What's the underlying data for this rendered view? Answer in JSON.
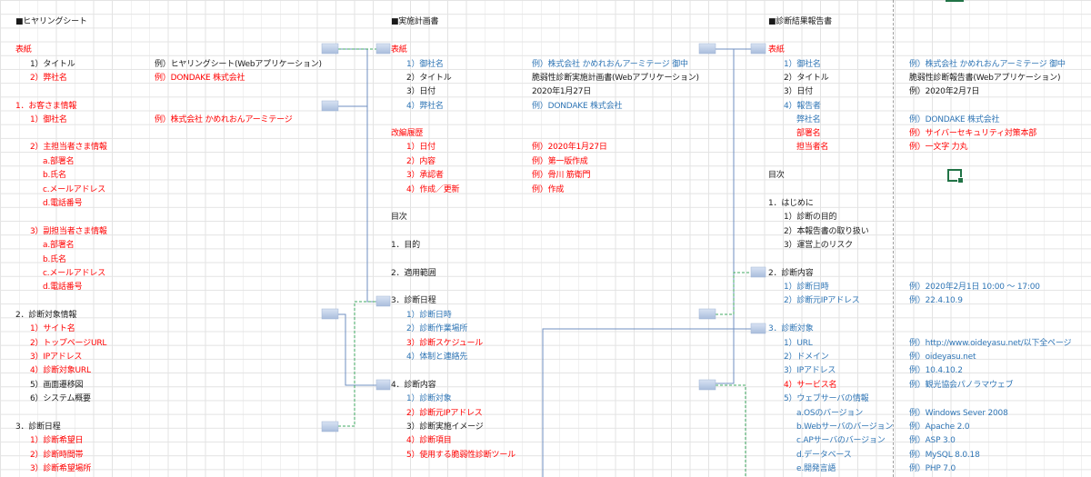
{
  "hearing_sheet": {
    "heading": "■ヒヤリングシート",
    "cover": "表紙",
    "title_label": "1）タイトル",
    "title_example": "例）ヒヤリングシート(Webアプリケーション)",
    "company_label": "2）弊社名",
    "company_example": "例）DONDAKE 株式会社",
    "customer_info": "1．お客さま情報",
    "customer_name": "1）御社名",
    "customer_name_example": "例）株式会社 かめれおんアーミテージ",
    "main_contact": "2）主担当者さま情報",
    "main_contact_items": [
      "a.部署名",
      "b.氏名",
      "c.メールアドレス",
      "d.電話番号"
    ],
    "sub_contact": "3）副担当者さま情報",
    "sub_contact_items": [
      "a.部署名",
      "b.氏名",
      "c.メールアドレス",
      "d.電話番号"
    ],
    "target_info": "2．診断対象情報",
    "site_name": "1）サイト名",
    "top_url": "2）トップページURL",
    "ip": "3）IPアドレス",
    "target_url": "4）診断対象URL",
    "screen_flow": "5）画面遷移図",
    "system_overview": "6）システム概要",
    "schedule": "3．診断日程",
    "preferred_date": "1）診断希望日",
    "preferred_time": "2）診断時間帯",
    "preferred_place": "3）診断希望場所"
  },
  "plan_doc": {
    "heading": "■実施計画書",
    "cover": "表紙",
    "customer_name": "1）御社名",
    "customer_name_example": "例）株式会社 かめれおんアーミテージ 御中",
    "title_label": "2）タイトル",
    "title_value": "脆弱性診断実施計画書(Webアプリケーション)",
    "date_label": "3）日付",
    "date_value": "2020年1月27日",
    "company_label": "4）弊社名",
    "company_example": "例）DONDAKE 株式会社",
    "revision": "改編履歴",
    "rev_date": "1）日付",
    "rev_date_example": "例）2020年1月27日",
    "rev_content": "2）内容",
    "rev_content_example": "例）第一版作成",
    "rev_approver": "3）承認者",
    "rev_approver_example": "例）骨川 筋衛門",
    "rev_author": "4）作成／更新",
    "rev_author_example": "例）作成",
    "toc": "目次",
    "purpose": "1．目的",
    "scope": "2．適用範囲",
    "schedule": "3．診断日程",
    "sched_items": [
      "1）診断日時",
      "2）診断作業場所",
      "3）診断スケジュール",
      "4）体制と連絡先"
    ],
    "content": "4．診断内容",
    "content_items": [
      "1）診断対象",
      "2）診断元IPアドレス",
      "3）診断実施イメージ",
      "4）診断項目",
      "5）使用する脆弱性診断ツール"
    ]
  },
  "report_doc": {
    "heading": "■診断結果報告書",
    "cover": "表紙",
    "customer_name": "1）御社名",
    "customer_name_example": "例）株式会社 かめれおんアーミテージ 御中",
    "title_label": "2）タイトル",
    "title_value": "脆弱性診断報告書(Webアプリケーション)",
    "date_label": "3）日付",
    "date_value": "例）2020年2月7日",
    "reporter": "4）報告者",
    "company_label": "弊社名",
    "company_example": "例）DONDAKE 株式会社",
    "dept_label": "部署名",
    "dept_example": "例）サイバーセキュリティ対策本部",
    "person_label": "担当者名",
    "person_example": "例）一文字 力丸",
    "toc": "目次",
    "intro": "1．はじめに",
    "intro_items": [
      "1）診断の目的",
      "2）本報告書の取り扱い",
      "3）運営上のリスク"
    ],
    "content": "2．診断内容",
    "dt_label": "1）診断日時",
    "dt_example": "例）2020年2月1日  10:00 ～ 17:00",
    "src_ip_label": "2）診断元IPアドレス",
    "src_ip_example": "例）22.4.10.9",
    "target": "3．診断対象",
    "url_label": "1）URL",
    "url_example": "例）http://www.oideyasu.net/以下全ページ",
    "domain_label": "2）ドメイン",
    "domain_example": "例）oideyasu.net",
    "ip_label": "3）IPアドレス",
    "ip_example": "例）10.4.10.2",
    "service_label": "4）サービス名",
    "service_example": "例）観光協会パノラマウェブ",
    "webinfo": "5）ウェブサーバの情報",
    "os_label": "a.OSのバージョン",
    "os_example": "例）Windows Sever 2008",
    "web_label": "b.Webサーバのバージョン",
    "web_example": "例）Apache 2.0",
    "ap_label": "c.APサーバのバージョン",
    "ap_example": "例）ASP 3.0",
    "db_label": "d.データベース",
    "db_example": "例）MySQL 8.0.18",
    "lang_label": "e.開発言語",
    "lang_example": "例）PHP 7.0"
  },
  "colors": {
    "required": "#ff0000",
    "example": "#2f75b5",
    "normal": "#1a1a1a",
    "grid": "#e3e3e3",
    "selection": "#217346"
  }
}
